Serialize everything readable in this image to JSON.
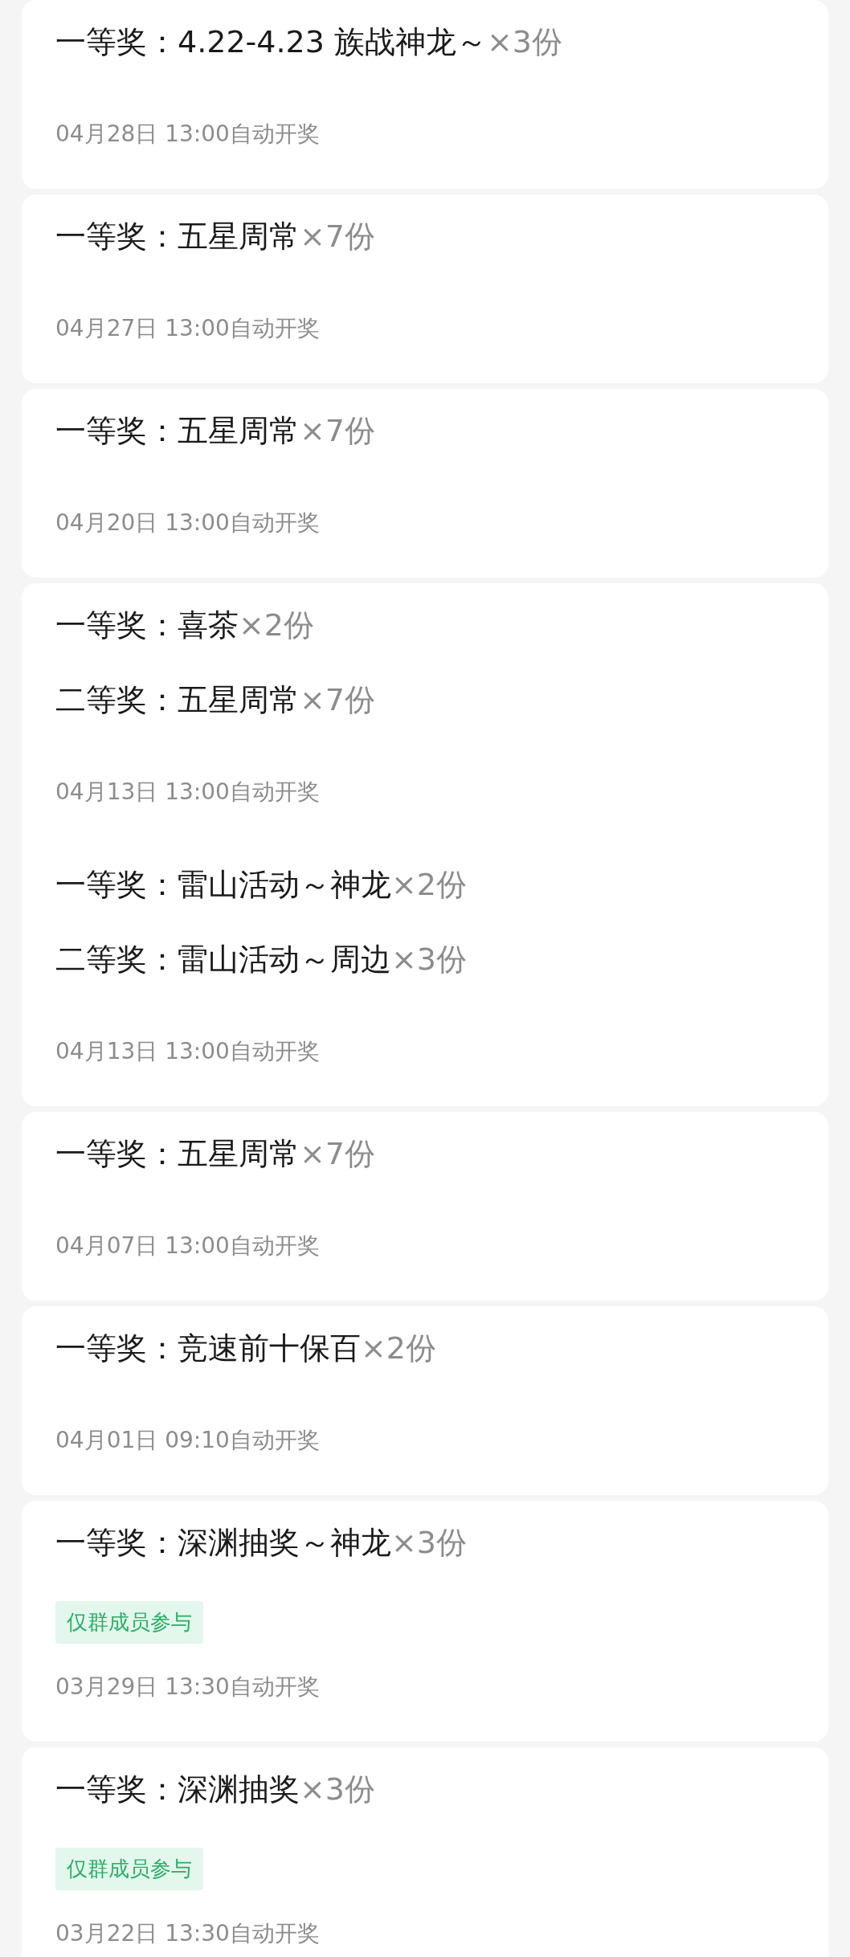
{
  "lotteries": [
    {
      "groups": [
        {
          "prizes": [
            {
              "rank": "一等奖：",
              "name": "4.22-4.23 族战神龙～",
              "count": "×3份"
            }
          ],
          "draw_time": "04月28日 13:00自动开奖"
        }
      ]
    },
    {
      "groups": [
        {
          "prizes": [
            {
              "rank": "一等奖：",
              "name": "五星周常",
              "count": "×7份"
            }
          ],
          "draw_time": "04月27日 13:00自动开奖"
        }
      ]
    },
    {
      "groups": [
        {
          "prizes": [
            {
              "rank": "一等奖：",
              "name": "五星周常",
              "count": "×7份"
            }
          ],
          "draw_time": "04月20日 13:00自动开奖"
        }
      ]
    },
    {
      "groups": [
        {
          "prizes": [
            {
              "rank": "一等奖：",
              "name": "喜茶",
              "count": "×2份"
            },
            {
              "rank": "二等奖：",
              "name": "五星周常",
              "count": "×7份"
            }
          ],
          "draw_time": "04月13日 13:00自动开奖"
        },
        {
          "prizes": [
            {
              "rank": "一等奖：",
              "name": "雷山活动～神龙",
              "count": "×2份"
            },
            {
              "rank": "二等奖：",
              "name": "雷山活动～周边",
              "count": "×3份"
            }
          ],
          "draw_time": "04月13日 13:00自动开奖"
        }
      ]
    },
    {
      "groups": [
        {
          "prizes": [
            {
              "rank": "一等奖：",
              "name": "五星周常",
              "count": "×7份"
            }
          ],
          "draw_time": "04月07日 13:00自动开奖"
        }
      ]
    },
    {
      "groups": [
        {
          "prizes": [
            {
              "rank": "一等奖：",
              "name": "竞速前十保百",
              "count": "×2份"
            }
          ],
          "draw_time": "04月01日 09:10自动开奖"
        }
      ]
    },
    {
      "groups": [
        {
          "prizes": [
            {
              "rank": "一等奖：",
              "name": "深渊抽奖～神龙",
              "count": "×3份"
            }
          ],
          "tag": "仅群成员参与",
          "draw_time": "03月29日 13:30自动开奖"
        }
      ]
    },
    {
      "groups": [
        {
          "prizes": [
            {
              "rank": "一等奖：",
              "name": "深渊抽奖",
              "count": "×3份"
            }
          ],
          "tag": "仅群成员参与",
          "draw_time": "03月22日 13:30自动开奖"
        }
      ]
    }
  ]
}
